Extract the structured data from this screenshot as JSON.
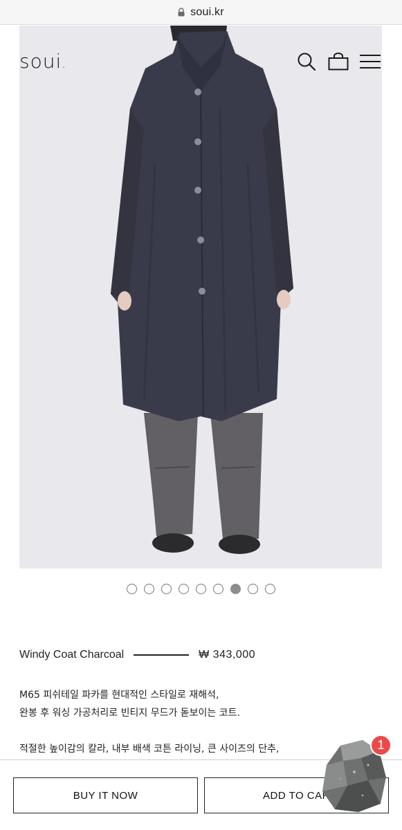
{
  "browser": {
    "url": "soui.kr"
  },
  "header": {
    "logo": "soui",
    "logo_dot": ".",
    "icons": [
      "search-icon",
      "shopping-bag-icon",
      "menu-icon"
    ]
  },
  "gallery": {
    "image_count": 9,
    "active_index": 6
  },
  "product": {
    "name": "Windy Coat Charcoal",
    "price": "₩ 343,000",
    "description": [
      "M65 피쉬테일 파카를 현대적인 스타일로 재해석,",
      "완봉 후 워싱 가공처리로 빈티지 무드가 돋보이는 코트.",
      "",
      "적절한 높이감의 칼라, 내부 배색 코튼 라이닝, 큰 사이즈의 단추,"
    ]
  },
  "actions": {
    "buy_label": "BUY IT NOW",
    "cart_label": "ADD TO CART"
  },
  "chat_widget": {
    "badge_count": "1"
  },
  "colors": {
    "hero_bg": "#e9e8ec",
    "coat": "#3a3b4a",
    "pants": "#5a585c",
    "badge": "#ec4a4a"
  }
}
